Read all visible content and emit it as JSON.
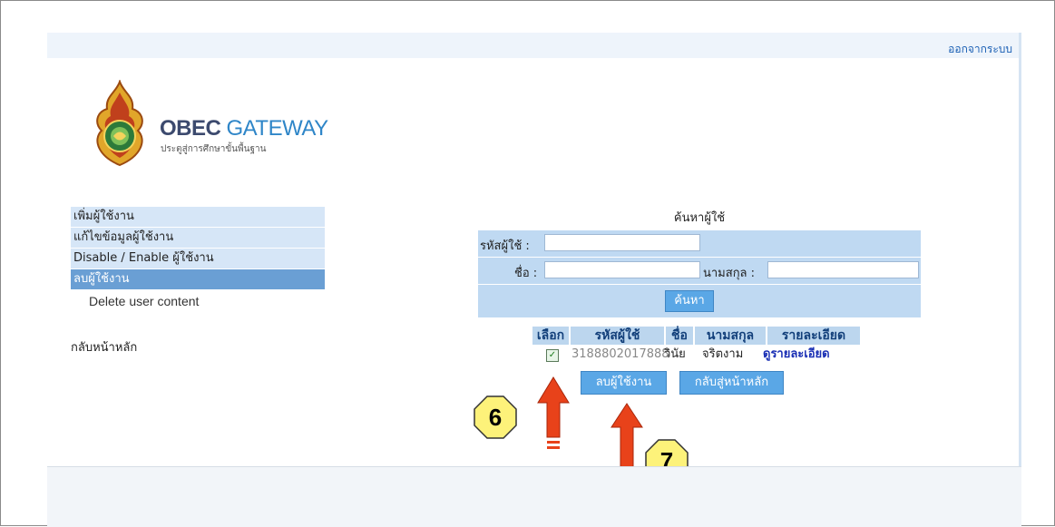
{
  "header": {
    "logout_label": "ออกจากระบบ"
  },
  "logo": {
    "title_main": "OBEC ",
    "title_accent": "GATEWAY",
    "subtitle": "ประตูสู่การศึกษาขั้นพื้นฐาน"
  },
  "sidebar": {
    "items": [
      {
        "label": "เพิ่มผู้ใช้งาน"
      },
      {
        "label": "แก้ไขข้อมูลผู้ใช้งาน"
      },
      {
        "label": "Disable / Enable ผู้ใช้งาน"
      },
      {
        "label": "ลบผู้ใช้งาน"
      }
    ],
    "sub_item": "Delete user content",
    "home": "กลับหน้าหลัก"
  },
  "search": {
    "title": "ค้นหาผู้ใช้",
    "userid_label": "รหัสผู้ใช้ :",
    "userid_value": "",
    "firstname_label": "ชื่อ :",
    "firstname_value": "",
    "lastname_label": "นามสกุล :",
    "lastname_value": "",
    "search_button": "ค้นหา"
  },
  "results": {
    "headers": [
      "เลือก",
      "รหัสผู้ใช้",
      "ชื่อ",
      "นามสกุล",
      "รายละเอียด"
    ],
    "row": {
      "checked": true,
      "userid": "3188802017888",
      "firstname": "วินัย",
      "lastname": "จริตงาม",
      "detail_link": "ดูรายละเอียด"
    },
    "delete_button": "ลบผู้ใช้งาน",
    "back_button": "กลับสู่หน้าหลัก"
  },
  "annotations": {
    "step_a": "6",
    "step_b": "7"
  },
  "colors": {
    "accent": "#5aa7e6",
    "menu_active": "#6a9fd4",
    "arrow": "#e8421a",
    "badge": "#fdf27a"
  }
}
